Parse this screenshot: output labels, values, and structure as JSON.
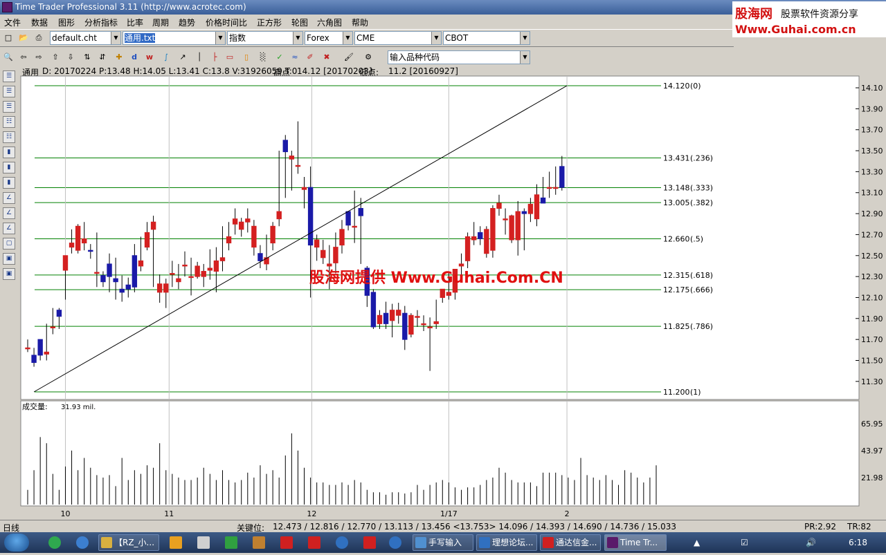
{
  "window": {
    "title": "Time Trader Professional 3.11 (http://www.acrotec.com)"
  },
  "logo": {
    "brand": "股海网",
    "slogan": "股票软件资源分享",
    "site": "Www.Guhai.com.cn"
  },
  "menu": [
    "文件",
    "数据",
    "图形",
    "分析指标",
    "比率",
    "周期",
    "趋势",
    "价格时间比",
    "正方形",
    "轮图",
    "六角图",
    "帮助"
  ],
  "toolbar": {
    "chart_file": "default.cht",
    "symbol_file": "通用.txt",
    "index_type": "指数",
    "market": "Forex",
    "exchange1": "CME",
    "exchange2": "CBOT",
    "symbol_input": "输入品种代码"
  },
  "info": {
    "name": "通用",
    "ohlc": "D: 20170224  P:13.48  H:14.05  L:13.41  C:13.8  V:31926059  T:0",
    "high_label": "高点",
    "high_value": "14.12 [20170203]",
    "low_label": "低点:",
    "low_value": "11.2 [20160927]"
  },
  "chart_data": [
    {
      "type": "candlestick",
      "title": "",
      "ylim": [
        11.15,
        14.2
      ],
      "y_ticks": [
        "14.10",
        "13.90",
        "13.70",
        "13.50",
        "13.30",
        "13.10",
        "12.90",
        "12.70",
        "12.50",
        "12.30",
        "12.10",
        "11.90",
        "11.70",
        "11.50",
        "11.30"
      ],
      "x_ticks": [
        "10",
        "11",
        "12",
        "1/17",
        "2"
      ],
      "x_tick_bars": [
        6.0,
        22.5,
        45.2,
        67.0,
        85.8
      ],
      "fib_levels": [
        {
          "value": 14.12,
          "label": "14.120",
          "ratio": "(0)"
        },
        {
          "value": 13.431,
          "label": "13.431",
          "ratio": "(.236)"
        },
        {
          "value": 13.148,
          "label": "13.148",
          "ratio": "(.333)"
        },
        {
          "value": 13.005,
          "label": "13.005",
          "ratio": "(.382)"
        },
        {
          "value": 12.66,
          "label": "12.660",
          "ratio": "(.5)"
        },
        {
          "value": 12.315,
          "label": "12.315",
          "ratio": "(.618)"
        },
        {
          "value": 12.175,
          "label": "12.175",
          "ratio": "(.666)"
        },
        {
          "value": 11.825,
          "label": "11.825",
          "ratio": "(.786)"
        },
        {
          "value": 11.2,
          "label": "11.200",
          "ratio": "(1)"
        }
      ],
      "trend_line": {
        "from_value": 11.2,
        "to_value": 14.12,
        "from_bar": 1,
        "to_bar": 85.8
      },
      "watermark": "股海网提供 Www.Guhai.Com.CN",
      "up_color": "#d42020",
      "down_color": "#1a1aa8",
      "grid_color": "#008000",
      "candles": [
        [
          11.62,
          11.7,
          11.62,
          11.58
        ],
        [
          11.55,
          11.62,
          11.48,
          11.44
        ],
        [
          11.7,
          11.62,
          11.55,
          11.5
        ],
        [
          11.56,
          11.85,
          11.58,
          11.5
        ],
        [
          11.82,
          12.0,
          11.82,
          11.75
        ],
        [
          11.98,
          12.0,
          11.92,
          11.8
        ],
        [
          12.36,
          12.38,
          12.5,
          12.08
        ],
        [
          12.58,
          12.75,
          12.62,
          12.52
        ],
        [
          12.55,
          12.8,
          12.78,
          12.52
        ],
        [
          12.62,
          12.82,
          12.66,
          12.55
        ],
        [
          12.55,
          12.61,
          12.54,
          12.47
        ],
        [
          12.34,
          12.72,
          12.34,
          12.2
        ],
        [
          12.31,
          12.35,
          12.25,
          12.2
        ],
        [
          12.42,
          12.52,
          12.3,
          12.15
        ],
        [
          12.28,
          12.48,
          12.25,
          12.08
        ],
        [
          12.18,
          12.31,
          12.15,
          12.06
        ],
        [
          12.22,
          12.29,
          12.18,
          12.1
        ],
        [
          12.5,
          12.61,
          12.2,
          12.15
        ],
        [
          12.4,
          12.68,
          12.45,
          12.35
        ],
        [
          12.58,
          12.82,
          12.72,
          12.55
        ],
        [
          12.75,
          12.88,
          12.82,
          12.2
        ],
        [
          12.15,
          12.32,
          12.23,
          12.05
        ],
        [
          12.15,
          12.28,
          12.23,
          12.0
        ],
        [
          12.33,
          12.45,
          12.33,
          12.2
        ],
        [
          12.25,
          12.42,
          12.28,
          12.18
        ],
        [
          12.4,
          12.54,
          12.41,
          12.3
        ],
        [
          12.3,
          12.48,
          12.3,
          12.12
        ],
        [
          12.3,
          12.44,
          12.4,
          12.28
        ],
        [
          12.3,
          12.42,
          12.35,
          12.2
        ],
        [
          12.36,
          12.56,
          12.38,
          12.27
        ],
        [
          12.35,
          12.58,
          12.45,
          12.15
        ],
        [
          12.45,
          12.78,
          12.48,
          12.35
        ],
        [
          12.62,
          12.82,
          12.68,
          12.55
        ],
        [
          12.8,
          12.95,
          12.85,
          12.7
        ],
        [
          12.75,
          12.86,
          12.82,
          12.68
        ],
        [
          12.82,
          12.95,
          12.85,
          12.72
        ],
        [
          12.58,
          12.84,
          12.78,
          12.5
        ],
        [
          12.52,
          12.6,
          12.45,
          12.38
        ],
        [
          12.42,
          12.7,
          12.48,
          12.36
        ],
        [
          12.62,
          12.82,
          12.78,
          12.55
        ],
        [
          12.85,
          13.5,
          12.92,
          12.78
        ],
        [
          13.6,
          13.65,
          13.49,
          13.05
        ],
        [
          13.42,
          13.5,
          13.45,
          13.12
        ],
        [
          13.35,
          13.78,
          13.36,
          13.28
        ],
        [
          13.13,
          13.25,
          13.15,
          12.95
        ],
        [
          13.15,
          13.35,
          12.6,
          12.1
        ],
        [
          12.58,
          12.7,
          12.65,
          12.45
        ],
        [
          12.48,
          12.65,
          12.55,
          12.42
        ],
        [
          12.4,
          12.6,
          12.42,
          12.18
        ],
        [
          12.43,
          12.72,
          12.58,
          12.33
        ],
        [
          12.6,
          12.84,
          12.75,
          12.52
        ],
        [
          12.92,
          12.9,
          12.79,
          12.74
        ],
        [
          12.78,
          13.12,
          12.78,
          12.62
        ],
        [
          12.95,
          13.05,
          12.88,
          12.42
        ],
        [
          12.38,
          12.4,
          12.12,
          12.01
        ],
        [
          12.15,
          12.18,
          11.82,
          11.8
        ],
        [
          11.85,
          11.98,
          11.93,
          11.8
        ],
        [
          11.95,
          12.06,
          11.85,
          11.8
        ],
        [
          11.88,
          12.04,
          11.98,
          11.72
        ],
        [
          11.93,
          12.05,
          11.98,
          11.85
        ],
        [
          11.95,
          12.02,
          11.7,
          11.6
        ],
        [
          11.75,
          11.95,
          11.93,
          11.72
        ],
        [
          11.92,
          11.98,
          11.92,
          11.82
        ],
        [
          11.85,
          11.93,
          11.85,
          11.78
        ],
        [
          11.82,
          11.91,
          11.82,
          11.4
        ],
        [
          11.85,
          12.08,
          11.87,
          11.8
        ],
        [
          12.1,
          12.18,
          12.18,
          12.05
        ],
        [
          12.12,
          12.35,
          12.15,
          12.08
        ],
        [
          12.15,
          12.34,
          12.37,
          12.08
        ],
        [
          12.4,
          12.52,
          12.42,
          12.3
        ],
        [
          12.45,
          12.72,
          12.68,
          12.38
        ],
        [
          12.65,
          12.82,
          12.68,
          12.6
        ],
        [
          12.72,
          12.78,
          12.66,
          12.6
        ],
        [
          12.52,
          12.78,
          12.75,
          12.48
        ],
        [
          12.55,
          12.98,
          12.95,
          12.48
        ],
        [
          12.95,
          13.08,
          13.0,
          12.88
        ],
        [
          12.85,
          12.95,
          12.85,
          12.7
        ],
        [
          12.65,
          12.89,
          12.88,
          12.62
        ],
        [
          12.65,
          13.02,
          12.92,
          12.5
        ],
        [
          12.92,
          12.95,
          12.9,
          12.55
        ],
        [
          12.9,
          13.05,
          12.99,
          12.82
        ],
        [
          12.85,
          13.18,
          13.08,
          12.78
        ],
        [
          13.05,
          13.25,
          13.0,
          13.0
        ],
        [
          13.15,
          13.3,
          13.15,
          13.05
        ],
        [
          13.15,
          13.35,
          13.15,
          13.08
        ],
        [
          13.35,
          13.45,
          13.15,
          13.12
        ]
      ]
    },
    {
      "type": "bar",
      "title": "成交量:",
      "current": "31.93 mil.",
      "ylim": [
        0,
        80
      ],
      "y_ticks": [
        "65.95",
        "43.97",
        "21.98"
      ],
      "values": [
        12,
        28,
        55,
        50,
        25,
        12,
        31,
        44,
        28,
        38,
        30,
        24,
        22,
        24,
        15,
        38,
        20,
        28,
        25,
        32,
        30,
        50,
        28,
        25,
        22,
        20,
        20,
        22,
        30,
        25,
        20,
        28,
        20,
        18,
        20,
        26,
        22,
        32,
        25,
        28,
        22,
        40,
        58,
        44,
        30,
        22,
        18,
        18,
        16,
        16,
        18,
        16,
        20,
        18,
        12,
        10,
        10,
        8,
        10,
        10,
        9,
        10,
        16,
        12,
        16,
        18,
        20,
        18,
        14,
        12,
        14,
        14,
        16,
        20,
        22,
        30,
        26,
        20,
        18,
        18,
        18,
        15,
        26,
        26,
        26,
        24,
        22,
        20,
        38,
        24,
        22,
        20,
        24,
        20,
        16,
        28,
        26,
        22,
        18,
        22,
        32
      ]
    }
  ],
  "status": {
    "mode": "日线",
    "key_label": "关键位:",
    "key_values": "12.473 / 12.816 / 12.770 / 13.113 / 13.456 <13.753> 14.096 / 14.393 / 14.690 / 14.736 / 15.033",
    "pr": "PR:2.92",
    "tr": "TR:82"
  },
  "taskbar": {
    "items": [
      "【RZ_小...",
      "手写输入",
      "理想论坛...",
      "通达信金...",
      "Time Tr..."
    ],
    "clock": "6:18"
  }
}
